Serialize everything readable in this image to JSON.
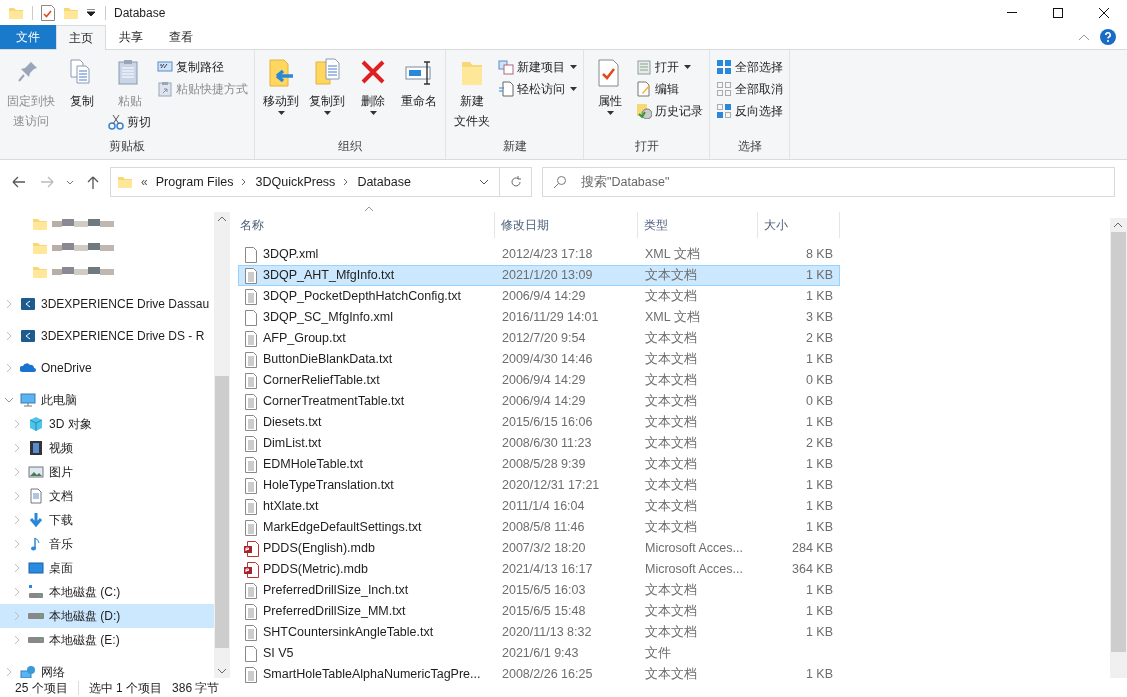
{
  "window": {
    "title": "Database"
  },
  "ribbon_tabs": [
    {
      "label": "文件",
      "kind": "file",
      "selected": false
    },
    {
      "label": "主页",
      "kind": "tab",
      "selected": true
    },
    {
      "label": "共享",
      "kind": "tab",
      "selected": false
    },
    {
      "label": "查看",
      "kind": "tab",
      "selected": false
    }
  ],
  "ribbon_groups": [
    {
      "label": "剪贴板",
      "buttons": [
        {
          "lines": [
            "固定到快",
            "速访问"
          ],
          "kind": "large",
          "disabled": true
        },
        {
          "lines": [
            "复制"
          ],
          "kind": "large",
          "disabled": false
        },
        {
          "lines": [
            "粘贴"
          ],
          "kind": "large",
          "disabled": true
        },
        {
          "label": "剪切",
          "kind": "sub",
          "disabled": false
        },
        {
          "label": "复制路径",
          "kind": "small",
          "disabled": false
        },
        {
          "label": "粘贴快捷方式",
          "kind": "small",
          "disabled": true
        }
      ]
    },
    {
      "label": "组织",
      "buttons": [
        {
          "lines": [
            "移动到"
          ],
          "kind": "large",
          "dropdown": true
        },
        {
          "lines": [
            "复制到"
          ],
          "kind": "large",
          "dropdown": true
        },
        {
          "lines": [
            "删除"
          ],
          "kind": "large",
          "dropdown": true
        },
        {
          "lines": [
            "重命名"
          ],
          "kind": "large"
        }
      ]
    },
    {
      "label": "新建",
      "buttons": [
        {
          "lines": [
            "新建",
            "文件夹"
          ],
          "kind": "large"
        },
        {
          "label": "新建项目",
          "kind": "small",
          "dropdown": true
        },
        {
          "label": "轻松访问",
          "kind": "small",
          "dropdown": true
        }
      ]
    },
    {
      "label": "打开",
      "buttons": [
        {
          "lines": [
            "属性"
          ],
          "kind": "large",
          "dropdown": true
        },
        {
          "label": "打开",
          "kind": "small",
          "dropdown": true
        },
        {
          "label": "编辑",
          "kind": "small"
        },
        {
          "label": "历史记录",
          "kind": "small"
        }
      ]
    },
    {
      "label": "选择",
      "buttons": [
        {
          "label": "全部选择",
          "kind": "small"
        },
        {
          "label": "全部取消",
          "kind": "small"
        },
        {
          "label": "反向选择",
          "kind": "small"
        }
      ]
    }
  ],
  "address_bar": {
    "overflow": "«",
    "crumbs": [
      "Program Files",
      "3DQuickPress",
      "Database"
    ]
  },
  "search": {
    "placeholder": "搜索\"Database\""
  },
  "sidebar": {
    "items": [
      {
        "kind": "blurred",
        "selected": false
      },
      {
        "kind": "blurred",
        "selected": false
      },
      {
        "kind": "blurred",
        "selected": false
      },
      {
        "kind": "cloud-drive",
        "label": "3DEXPERIENCE Drive Dassau",
        "expanded": false,
        "selected": false
      },
      {
        "kind": "cloud-drive",
        "label": "3DEXPERIENCE Drive DS - R",
        "expanded": false,
        "selected": false
      },
      {
        "kind": "onedrive",
        "label": "OneDrive",
        "expanded": false,
        "selected": false
      },
      {
        "kind": "pc",
        "label": "此电脑",
        "expanded": true,
        "selected": false,
        "children": [
          {
            "kind": "objects",
            "label": "3D 对象",
            "expanded": false,
            "selected": false
          },
          {
            "kind": "video",
            "label": "视频",
            "expanded": false,
            "selected": false
          },
          {
            "kind": "pictures",
            "label": "图片",
            "expanded": false,
            "selected": false
          },
          {
            "kind": "documents",
            "label": "文档",
            "expanded": false,
            "selected": false
          },
          {
            "kind": "downloads",
            "label": "下载",
            "expanded": false,
            "selected": false
          },
          {
            "kind": "music",
            "label": "音乐",
            "expanded": false,
            "selected": false
          },
          {
            "kind": "desktop",
            "label": "桌面",
            "expanded": false,
            "selected": false
          },
          {
            "kind": "system-disk",
            "label": "本地磁盘 (C:)",
            "expanded": false,
            "selected": false
          },
          {
            "kind": "disk",
            "label": "本地磁盘 (D:)",
            "expanded": false,
            "selected": true
          },
          {
            "kind": "disk",
            "label": "本地磁盘 (E:)",
            "expanded": false,
            "selected": false
          }
        ]
      },
      {
        "kind": "network",
        "label": "网络",
        "expanded": false,
        "selected": false
      }
    ]
  },
  "table": {
    "columns": [
      "名称",
      "修改日期",
      "类型",
      "大小"
    ],
    "rows": [
      {
        "kind": "blank",
        "name": "3DQP.xml",
        "date": "2012/4/23 17:18",
        "type": "XML 文档",
        "size": "8 KB",
        "selected": false
      },
      {
        "kind": "text",
        "name": "3DQP_AHT_MfgInfo.txt",
        "date": "2021/1/20 13:09",
        "type": "文本文档",
        "size": "1 KB",
        "selected": true
      },
      {
        "kind": "text",
        "name": "3DQP_PocketDepthHatchConfig.txt",
        "date": "2006/9/4 14:29",
        "type": "文本文档",
        "size": "1 KB",
        "selected": false
      },
      {
        "kind": "blank",
        "name": "3DQP_SC_MfgInfo.xml",
        "date": "2016/11/29 14:01",
        "type": "XML 文档",
        "size": "3 KB",
        "selected": false
      },
      {
        "kind": "text",
        "name": "AFP_Group.txt",
        "date": "2012/7/20 9:54",
        "type": "文本文档",
        "size": "2 KB",
        "selected": false
      },
      {
        "kind": "text",
        "name": "ButtonDieBlankData.txt",
        "date": "2009/4/30 14:46",
        "type": "文本文档",
        "size": "1 KB",
        "selected": false
      },
      {
        "kind": "text",
        "name": "CornerReliefTable.txt",
        "date": "2006/9/4 14:29",
        "type": "文本文档",
        "size": "0 KB",
        "selected": false
      },
      {
        "kind": "text",
        "name": "CornerTreatmentTable.txt",
        "date": "2006/9/4 14:29",
        "type": "文本文档",
        "size": "0 KB",
        "selected": false
      },
      {
        "kind": "text",
        "name": "Diesets.txt",
        "date": "2015/6/15 16:06",
        "type": "文本文档",
        "size": "1 KB",
        "selected": false
      },
      {
        "kind": "text",
        "name": "DimList.txt",
        "date": "2008/6/30 11:23",
        "type": "文本文档",
        "size": "2 KB",
        "selected": false
      },
      {
        "kind": "text",
        "name": "EDMHoleTable.txt",
        "date": "2008/5/28 9:39",
        "type": "文本文档",
        "size": "1 KB",
        "selected": false
      },
      {
        "kind": "text",
        "name": "HoleTypeTranslation.txt",
        "date": "2020/12/31 17:21",
        "type": "文本文档",
        "size": "1 KB",
        "selected": false
      },
      {
        "kind": "text",
        "name": "htXlate.txt",
        "date": "2011/1/4 16:04",
        "type": "文本文档",
        "size": "1 KB",
        "selected": false
      },
      {
        "kind": "text",
        "name": "MarkEdgeDefaultSettings.txt",
        "date": "2008/5/8 11:46",
        "type": "文本文档",
        "size": "1 KB",
        "selected": false
      },
      {
        "kind": "access",
        "name": "PDDS(English).mdb",
        "date": "2007/3/2 18:20",
        "type": "Microsoft Acces...",
        "size": "284 KB",
        "selected": false
      },
      {
        "kind": "access",
        "name": "PDDS(Metric).mdb",
        "date": "2021/4/13 16:17",
        "type": "Microsoft Acces...",
        "size": "364 KB",
        "selected": false
      },
      {
        "kind": "text",
        "name": "PreferredDrillSize_Inch.txt",
        "date": "2015/6/5 16:03",
        "type": "文本文档",
        "size": "1 KB",
        "selected": false
      },
      {
        "kind": "text",
        "name": "PreferredDrillSize_MM.txt",
        "date": "2015/6/5 15:48",
        "type": "文本文档",
        "size": "1 KB",
        "selected": false
      },
      {
        "kind": "text",
        "name": "SHTCountersinkAngleTable.txt",
        "date": "2020/11/13 8:32",
        "type": "文本文档",
        "size": "1 KB",
        "selected": false
      },
      {
        "kind": "blank",
        "name": "SI V5",
        "date": "2021/6/1 9:43",
        "type": "文件",
        "selected": false
      },
      {
        "kind": "text",
        "name": "SmartHoleTableAlphaNumericTagPre...",
        "date": "2008/2/26 16:25",
        "type": "文本文档",
        "size": "1 KB",
        "selected": false
      }
    ]
  },
  "status_bar": {
    "item_count": "25 个项目",
    "selection": "选中 1 个项目",
    "selection_size": "386 字节"
  }
}
